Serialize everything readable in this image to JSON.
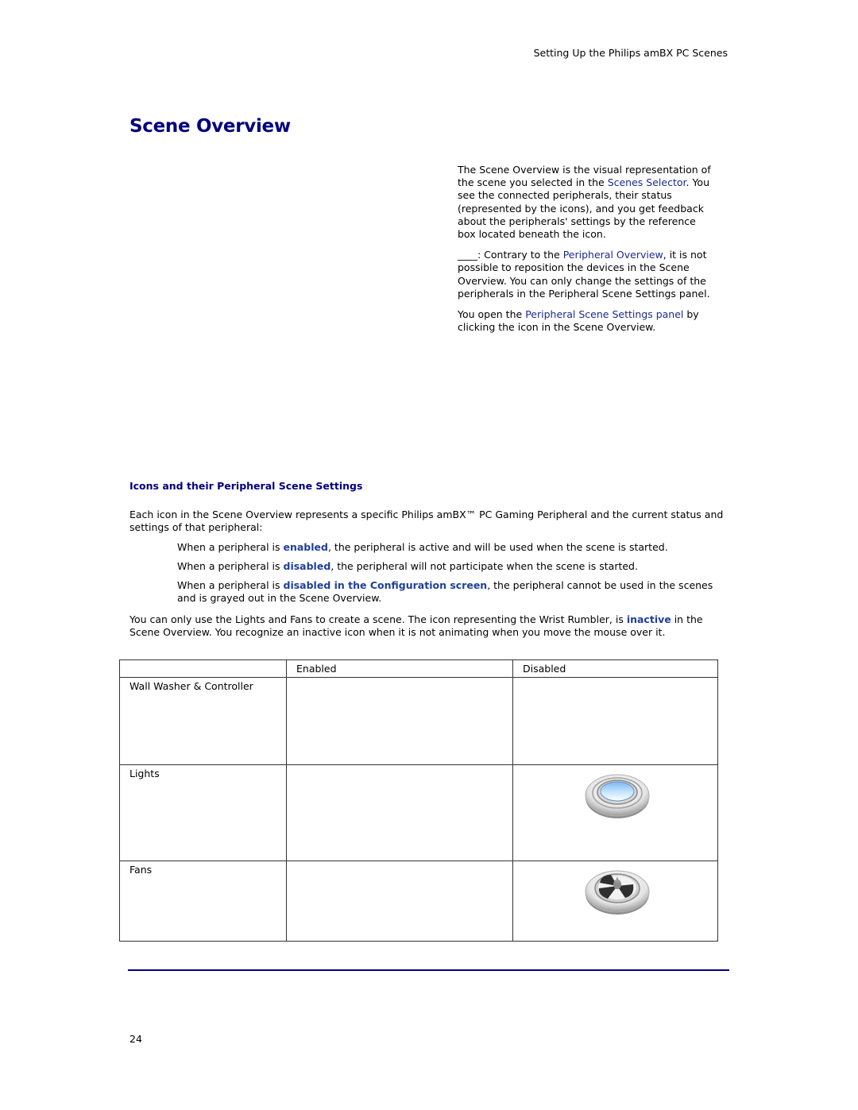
{
  "header": {
    "running_title": "Setting Up the Philips amBX PC Scenes"
  },
  "page_title": "Scene Overview",
  "intro": {
    "p1": {
      "before": "The Scene Overview is the visual representation of the scene you selected in the ",
      "link": "Scenes Selector",
      "after": ". You see the connected peripherals, their status (represented by the icons), and you get feedback about the peripherals' settings by the reference box located beneath the icon."
    },
    "p2": {
      "before": "____: Contrary to the ",
      "link": "Peripheral Overview",
      "after": ", it is not possible to reposition the devices in the Scene Overview. You can only change the settings of the peripherals in the Peripheral Scene Settings panel."
    },
    "p3": {
      "before": "You open the ",
      "link": "Peripheral Scene Settings panel",
      "after": " by clicking the icon in the Scene Overview."
    }
  },
  "section": {
    "heading": "Icons and their Peripheral Scene Settings",
    "para1": "Each icon in the Scene Overview represents a specific Philips amBX™ PC Gaming Peripheral and the current status and settings of that peripheral:",
    "bullets": [
      {
        "before": "When a peripheral is ",
        "term": "enabled",
        "after": ", the peripheral is active and will be used when the scene is started."
      },
      {
        "before": "When a peripheral is ",
        "term": "disabled",
        "after": ", the peripheral will not participate when the scene is started."
      },
      {
        "before": "When a peripheral is ",
        "term": "disabled in the Configuration screen",
        "after": ", the peripheral cannot be used in the scenes and is grayed out in the Scene Overview."
      }
    ],
    "para2": {
      "before": "You can only use the Lights and Fans to create a scene. The icon representing the Wrist Rumbler, is ",
      "term": "inactive",
      "after": " in the Scene Overview. You recognize an inactive icon when it is not animating when you move the mouse over it."
    }
  },
  "table": {
    "headers": [
      "",
      "Enabled",
      "Disabled"
    ],
    "rows": [
      {
        "label": "Wall Washer & Controller",
        "enabled_icon": "",
        "disabled_icon": ""
      },
      {
        "label": "Lights",
        "enabled_icon": "",
        "disabled_icon": "light-icon"
      },
      {
        "label": "Fans",
        "enabled_icon": "",
        "disabled_icon": "fan-icon"
      }
    ]
  },
  "footer": {
    "page_number": "24"
  }
}
